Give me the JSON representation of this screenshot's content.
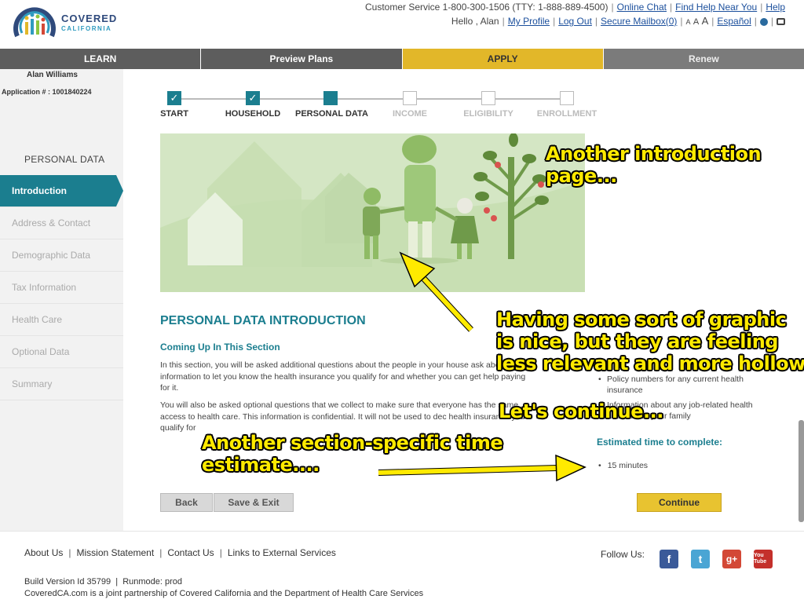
{
  "header": {
    "logo": {
      "line1": "COVERED",
      "line2": "CALIFORNIA"
    },
    "customer_service": "Customer Service 1-800-300-1506 (TTY: 1-888-889-4500)",
    "online_chat": "Online Chat",
    "find_help": "Find Help Near You",
    "help": "Help",
    "greeting": "Hello , Alan",
    "my_profile": "My Profile",
    "log_out": "Log Out",
    "secure_mailbox": "Secure Mailbox(0)",
    "text_size": [
      "A",
      "A",
      "A"
    ],
    "language": "Español"
  },
  "nav": {
    "items": [
      {
        "label": "LEARN"
      },
      {
        "label": "Preview Plans"
      },
      {
        "label": "APPLY",
        "active": true
      },
      {
        "label": "Renew"
      }
    ]
  },
  "sidebar": {
    "user_name": "Alan Williams",
    "application_number": "Application # : 1001840224",
    "section_title": "PERSONAL DATA",
    "items": [
      {
        "label": "Introduction",
        "active": true
      },
      {
        "label": "Address & Contact"
      },
      {
        "label": "Demographic Data"
      },
      {
        "label": "Tax Information"
      },
      {
        "label": "Health Care"
      },
      {
        "label": "Optional Data"
      },
      {
        "label": "Summary"
      }
    ]
  },
  "tracker": {
    "steps": [
      {
        "label": "START",
        "state": "done"
      },
      {
        "label": "HOUSEHOLD",
        "state": "done"
      },
      {
        "label": "PERSONAL DATA",
        "state": "current"
      },
      {
        "label": "INCOME",
        "state": "pending"
      },
      {
        "label": "ELIGIBILITY",
        "state": "pending"
      },
      {
        "label": "ENROLLMENT",
        "state": "pending"
      }
    ]
  },
  "main": {
    "title": "PERSONAL DATA INTRODUCTION",
    "subtitle": "Coming Up In This Section",
    "paragraph1": "In this section, you will be asked additional questions about the people in your house ask about this information to let you know the health insurance you qualify for and whether you can get help paying for it.",
    "paragraph2": "You will also be asked optional questions that we collect to make sure that everyone has the same access to health care. This information is confidential. It will not be used to dec health insurance you qualify for",
    "right_list": [
      "Policy numbers for any current health insurance",
      "Information about any job-related health available to your family"
    ],
    "estimate_title": "Estimated time to complete:",
    "estimate_items": [
      "15 minutes"
    ]
  },
  "buttons": {
    "back": "Back",
    "save_exit": "Save & Exit",
    "continue": "Continue"
  },
  "footer": {
    "links": [
      "About Us",
      "Mission Statement",
      "Contact Us",
      "Links to External Services"
    ],
    "build": "Build Version Id 35799",
    "runmode": "Runmode: prod",
    "partnership": "CoveredCA.com is a joint partnership of Covered California and the Department of Health Care Services",
    "follow_us": "Follow Us:",
    "social": [
      "f",
      "t",
      "g+",
      "You Tube"
    ]
  },
  "annotations": {
    "a1": [
      "Another introduction",
      "page..."
    ],
    "a2": [
      "Having some sort of graphic",
      "is nice, but they are feeling",
      "less relevant and more hollow."
    ],
    "a3": "Let's continue...",
    "a4": [
      "Another section-specific time",
      "estimate...."
    ]
  },
  "colors": {
    "teal": "#1b7e8f",
    "nav_active": "#e2b729",
    "annotation": "#ffea00"
  }
}
